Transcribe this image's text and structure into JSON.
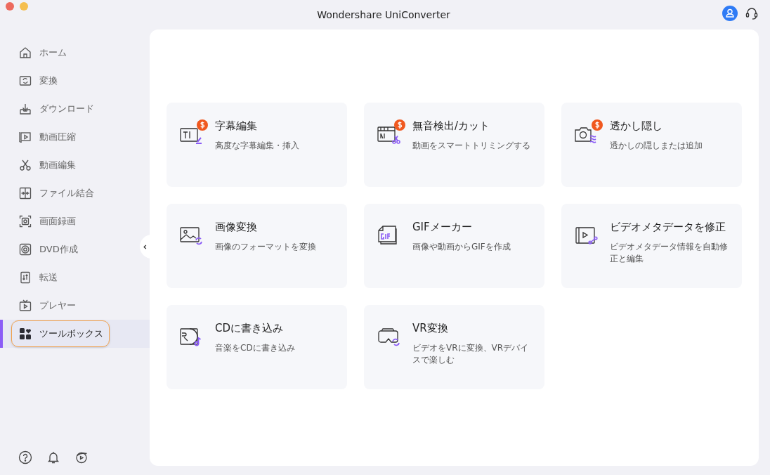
{
  "window": {
    "title": "Wondershare UniConverter"
  },
  "sidebar": {
    "items": [
      {
        "label": "ホーム",
        "selected": false
      },
      {
        "label": "変換",
        "selected": false
      },
      {
        "label": "ダウンロード",
        "selected": false
      },
      {
        "label": "動画圧縮",
        "selected": false
      },
      {
        "label": "動画編集",
        "selected": false
      },
      {
        "label": "ファイル結合",
        "selected": false
      },
      {
        "label": "画面録画",
        "selected": false
      },
      {
        "label": "DVD作成",
        "selected": false
      },
      {
        "label": "転送",
        "selected": false
      },
      {
        "label": "プレヤー",
        "selected": false
      },
      {
        "label": "ツールボックス",
        "selected": true
      }
    ]
  },
  "tools": [
    {
      "title": "字幕編集",
      "description": "高度な字幕編集・挿入",
      "paid": true
    },
    {
      "title": "無音検出/カット",
      "description": "動画をスマートトリミングする",
      "paid": true
    },
    {
      "title": "透かし隠し",
      "description": "透かしの隠しまたは追加",
      "paid": true
    },
    {
      "title": "画像変換",
      "description": "画像のフォーマットを変換",
      "paid": false
    },
    {
      "title": "GIFメーカー",
      "description": "画像や動画からGIFを作成",
      "paid": false
    },
    {
      "title": "ビデオメタデータを修正",
      "description": "ビデオメタデータ情報を自動修正と編集",
      "paid": false
    },
    {
      "title": "CDに書き込み",
      "description": "音楽をCDに書き込み",
      "paid": false
    },
    {
      "title": "VR変換",
      "description": "ビデオをVRに変換、VRデバイスで楽しむ",
      "paid": false
    }
  ]
}
